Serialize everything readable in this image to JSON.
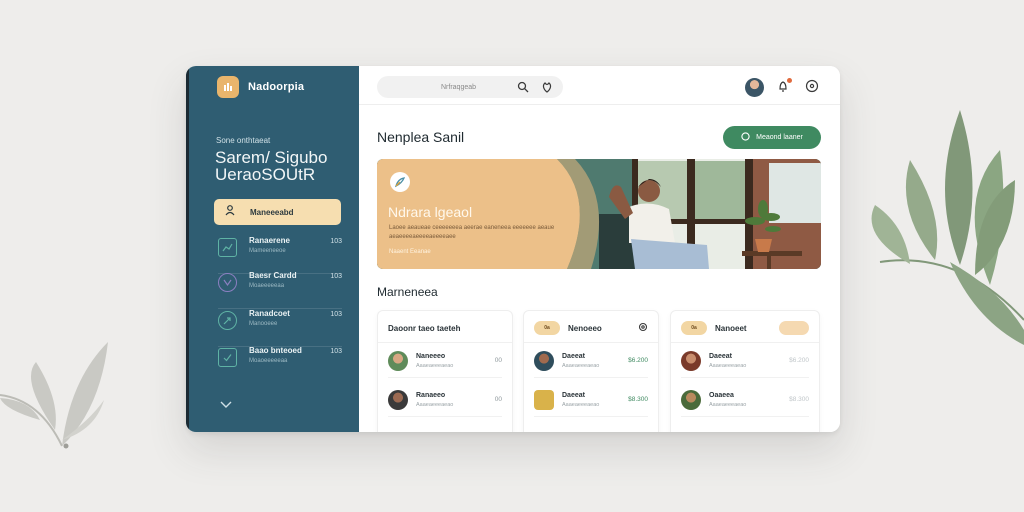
{
  "app": {
    "brand": "Nadoorpia"
  },
  "sidebar": {
    "subtitle": "Sone onthtaeat",
    "heading_line1": "Sarem/ Sigubo",
    "heading_line2": "UeraoSOUtR",
    "active_item": {
      "label": "Maneeeabd",
      "icon": "person-icon"
    },
    "items": [
      {
        "title": "Ranaerene",
        "subtitle": "Mameeneeoe",
        "count": "103",
        "icon": "chart-icon"
      },
      {
        "title": "Baesr Cardd",
        "subtitle": "Moaeeeeeaa",
        "count": "103",
        "icon": "shield-icon"
      },
      {
        "title": "Ranadcoet",
        "subtitle": "Manooeee",
        "count": "103",
        "icon": "compass-icon"
      },
      {
        "title": "Baao bnteoed",
        "subtitle": "Moaoeeeeeaa",
        "count": "103",
        "icon": "check-square-icon"
      }
    ],
    "expand_icon": "chevron-down-icon"
  },
  "topbar": {
    "search_placeholder": "Nrfraqgeab",
    "icons": [
      "search-icon",
      "filter-icon",
      "avatar",
      "bell-icon",
      "settings-icon"
    ]
  },
  "main": {
    "page_title": "Nenplea Sanil",
    "cta_label": "Meaond laaner",
    "hero": {
      "title": "Ndrara lgeaol",
      "description": "Laoee aeaueae ceeeeeeea aeerae eaneneea eeeeeee aeaue aeaeeeeaeeeeaeeeeaee",
      "footer": "Naaent Eeanae"
    },
    "section_title": "Marneneea"
  },
  "cards": [
    {
      "title": "Daoonr taeo taeteh",
      "rows": [
        {
          "name": "Naneeeo",
          "sub": "Aaaeaeeeaeao",
          "value": "00"
        },
        {
          "name": "Ranaeeo",
          "sub": "Aaaeaeeeaeao",
          "value": "00"
        }
      ]
    },
    {
      "pill": "0a",
      "title": "Nenoeeo",
      "rows": [
        {
          "name": "Daeeat",
          "sub": "Aaaeaeeeaeao",
          "value": "$6.200"
        },
        {
          "name": "Daeeat",
          "sub": "Aaaeaeeeaeao",
          "value": "$8.300"
        }
      ]
    },
    {
      "pill": "0a",
      "title": "Nanoeet",
      "rows": [
        {
          "name": "Daeeat",
          "sub": "Aaaeaeeeaeao",
          "value": "$6.200"
        },
        {
          "name": "Oaaeea",
          "sub": "Aaaeaeeeaeao",
          "value": "$8.300"
        }
      ]
    }
  ],
  "colors": {
    "sidebar": "#2f5d72",
    "accent_green": "#3f8a61",
    "accent_sand": "#f6deb0",
    "background": "#eeedeb"
  }
}
